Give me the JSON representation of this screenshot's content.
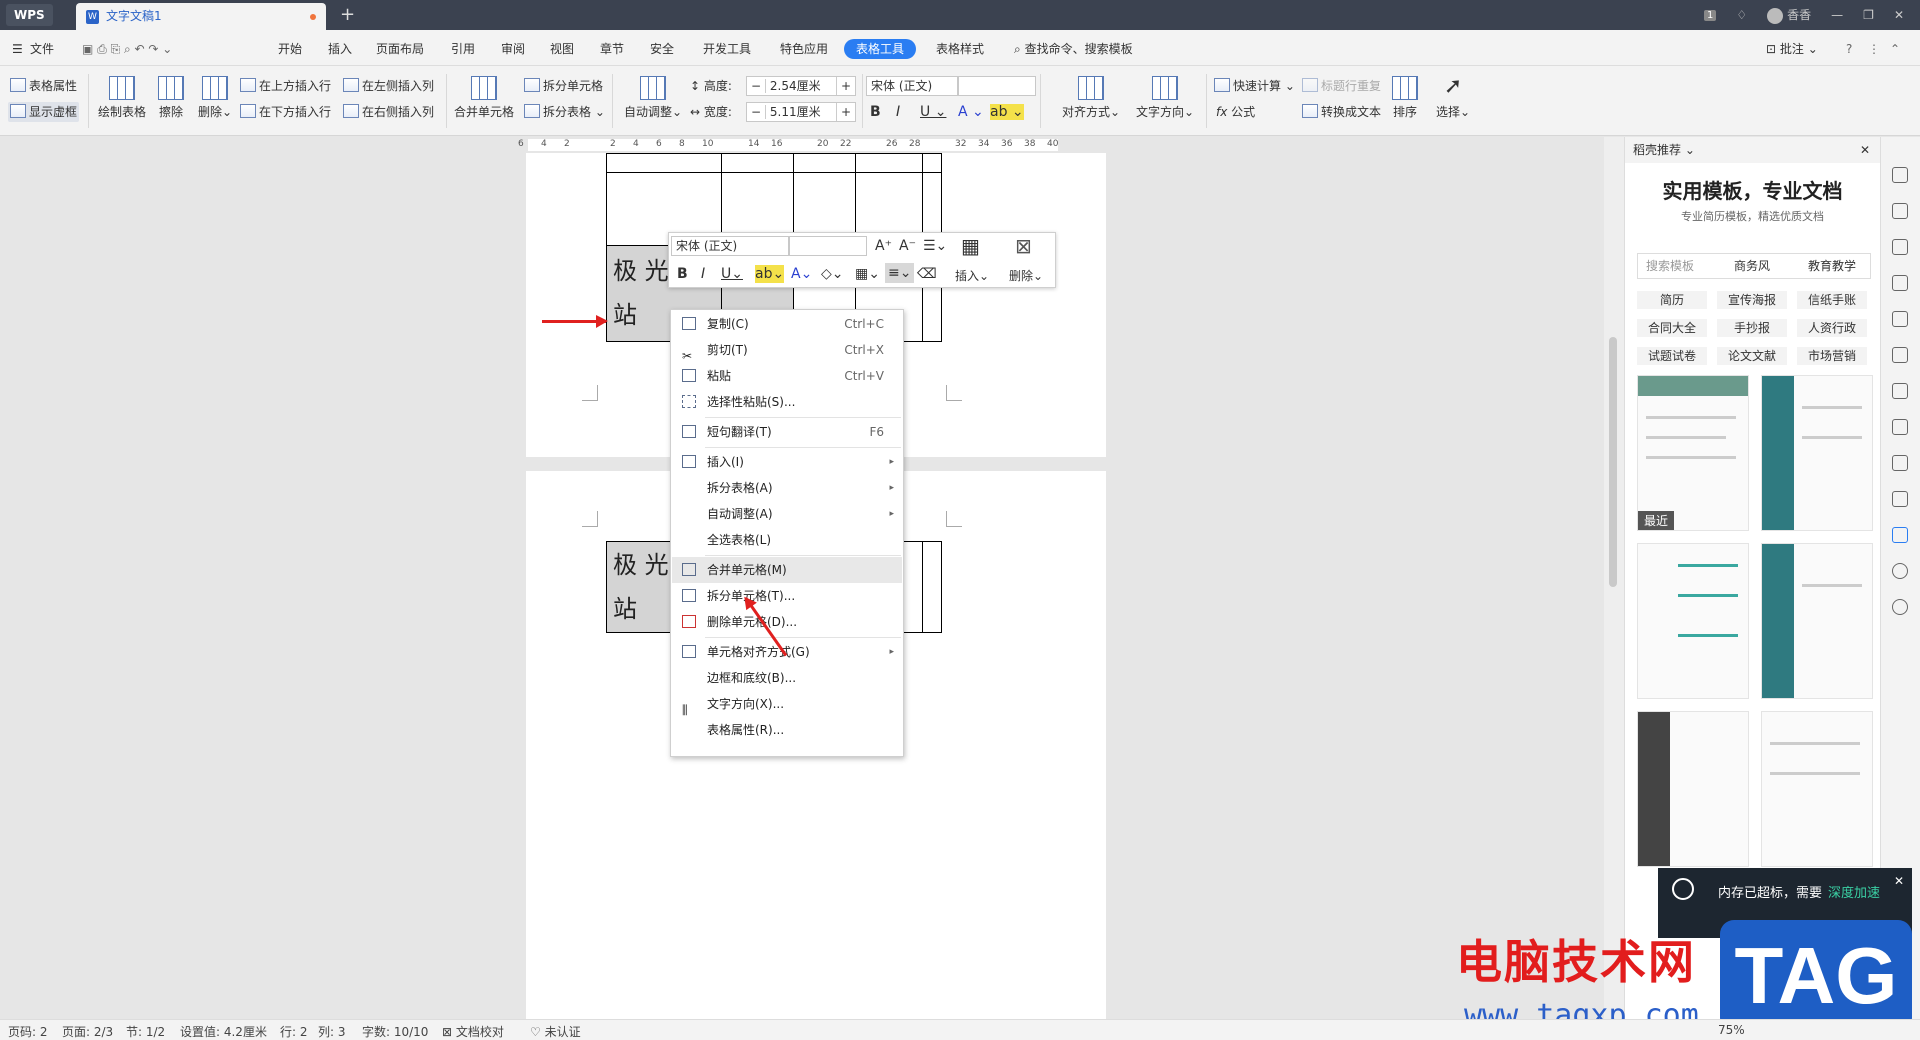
{
  "titlebar": {
    "app": "WPS",
    "tab": "文字文稿1",
    "user": "香香",
    "count": "1"
  },
  "menubar": {
    "items": [
      "文件",
      "开始",
      "插入",
      "页面布局",
      "引用",
      "审阅",
      "视图",
      "章节",
      "安全",
      "开发工具",
      "特色应用",
      "表格工具",
      "表格样式"
    ],
    "search": "查找命令、搜索模板",
    "annotate": "批注"
  },
  "ribbon": {
    "table_props": "表格属性",
    "show_gridlines": "显示虚框",
    "draw_table": "绘制表格",
    "erase": "擦除",
    "delete": "删除",
    "insert_above": "在上方插入行",
    "insert_below": "在下方插入行",
    "insert_left": "在左侧插入列",
    "insert_right": "在右侧插入列",
    "merge_cells": "合并单元格",
    "split_cell": "拆分单元格",
    "split_table": "拆分表格",
    "auto_fit": "自动调整",
    "height_label": "高度:",
    "height_value": "2.54厘米",
    "width_label": "宽度:",
    "width_value": "5.11厘米",
    "font": "宋体 (正文)",
    "align": "对齐方式",
    "text_dir": "文字方向",
    "quick_calc": "快速计算",
    "repeat_header": "标题行重复",
    "formula": "公式",
    "to_text": "转换成文本",
    "sort": "排序",
    "select": "选择"
  },
  "ruler": {
    "ticks": [
      "6",
      "4",
      "2",
      "",
      "2",
      "4",
      "6",
      "8",
      "10",
      "",
      "14",
      "16",
      "",
      "20",
      "22",
      "",
      "26",
      "28",
      "",
      "32",
      "34",
      "36",
      "38",
      "40"
    ]
  },
  "document": {
    "cell_line1": "极 光",
    "cell_line2": "站"
  },
  "minitoolbar": {
    "font": "宋体 (正文)",
    "size": "",
    "insert": "插入",
    "delete": "删除"
  },
  "context_menu": {
    "copy": "复制(C)",
    "copy_sc": "Ctrl+C",
    "cut": "剪切(T)",
    "cut_sc": "Ctrl+X",
    "paste": "粘贴",
    "paste_sc": "Ctrl+V",
    "paste_special": "选择性粘贴(S)...",
    "translate": "短句翻译(T)",
    "translate_sc": "F6",
    "insert": "插入(I)",
    "split_table": "拆分表格(A)",
    "auto_fit": "自动调整(A)",
    "select_table": "全选表格(L)",
    "merge": "合并单元格(M)",
    "split_cell": "拆分单元格(T)...",
    "delete_cell": "删除单元格(D)...",
    "cell_align": "单元格对齐方式(G)",
    "borders": "边框和底纹(B)...",
    "text_dir": "文字方向(X)...",
    "table_props": "表格属性(R)..."
  },
  "panel": {
    "header": "稻壳推荐",
    "title": "实用模板，专业文档",
    "subtitle": "专业简历模板，精选优质文档",
    "search": "搜索模板",
    "tags": [
      "商务风",
      "教育教学",
      "简历",
      "宣传海报",
      "信纸手账",
      "合同大全",
      "手抄报",
      "人资行政",
      "试题试卷",
      "论文文献",
      "市场营销"
    ],
    "recent": "最近"
  },
  "memtip": {
    "text": "内存已超标，需要",
    "highlight": "深度加速"
  },
  "statusbar": {
    "page_num": "页码: 2",
    "page": "页面: 2/3",
    "section": "节: 1/2",
    "setting": "设置值: 4.2厘米",
    "row": "行: 2",
    "col": "列: 3",
    "words": "字数: 10/10",
    "proof": "文档校对",
    "cert": "未认证",
    "zoom": "75%"
  },
  "watermark": {
    "site": "电脑技术网",
    "url": "www.tagxp.com",
    "tag": "TAG"
  },
  "colors": {
    "accent": "#2a7df2",
    "titlebar": "#3b4250",
    "arrow": "#e0201f"
  }
}
